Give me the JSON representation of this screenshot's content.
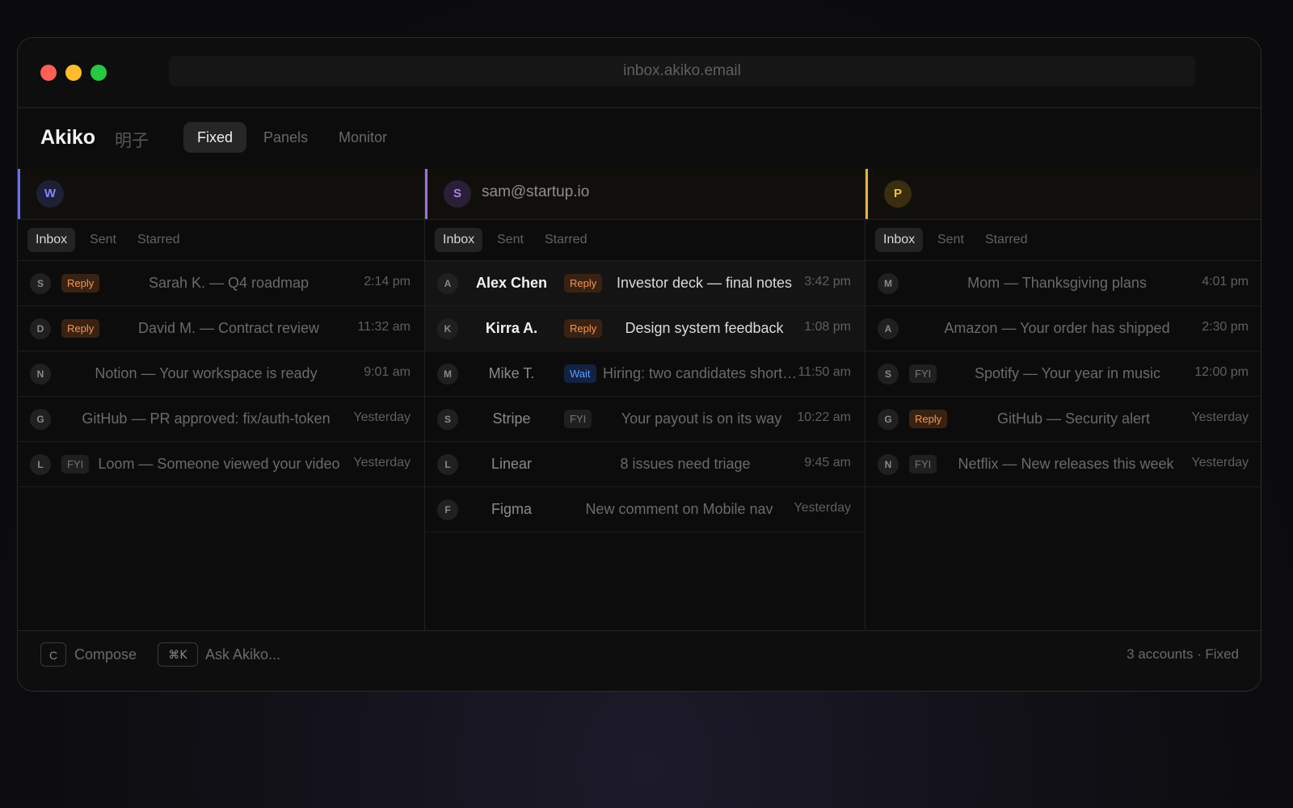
{
  "browser": {
    "url": "inbox.akiko.email"
  },
  "app": {
    "name": "Akiko",
    "name_jp": "明子"
  },
  "modes": [
    {
      "label": "Fixed",
      "active": true
    },
    {
      "label": "Panels",
      "active": false
    },
    {
      "label": "Monitor",
      "active": false
    }
  ],
  "columns": [
    {
      "initial": "W",
      "email": "",
      "accent": "#6b6ff0",
      "tabs": [
        "Inbox",
        "Sent",
        "Starred"
      ],
      "rows": [
        {
          "initial": "S",
          "badge": "Reply",
          "subject": "Sarah K. — Q4 roadmap",
          "time": "2:14 pm"
        },
        {
          "initial": "D",
          "badge": "Reply",
          "subject": "David M. — Contract review",
          "time": "11:32 am"
        },
        {
          "initial": "N",
          "badge": "",
          "subject": "Notion — Your workspace is ready",
          "time": "9:01 am"
        },
        {
          "initial": "G",
          "badge": "",
          "subject": "GitHub — PR approved: fix/auth-token",
          "time": "Yesterday"
        },
        {
          "initial": "L",
          "badge": "FYI",
          "subject": "Loom — Someone viewed your video",
          "time": "Yesterday"
        }
      ]
    },
    {
      "initial": "S",
      "email": "sam@startup.io",
      "accent": "#a070e0",
      "tabs": [
        "Inbox",
        "Sent",
        "Starred"
      ],
      "rows": [
        {
          "initial": "A",
          "sender": "Alex Chen",
          "badge": "Reply",
          "subject": "Investor deck — final notes",
          "time": "3:42 pm"
        },
        {
          "initial": "K",
          "sender": "Kirra A.",
          "badge": "Reply",
          "subject": "Design system feedback",
          "time": "1:08 pm"
        },
        {
          "initial": "M",
          "sender": "Mike T.",
          "badge": "Wait",
          "subject": "Hiring: two candidates shortlisted",
          "time": "11:50 am"
        },
        {
          "initial": "S",
          "sender": "Stripe",
          "badge": "FYI",
          "subject": "Your payout is on its way",
          "time": "10:22 am"
        },
        {
          "initial": "L",
          "sender": "Linear",
          "badge": "",
          "subject": "8 issues need triage",
          "time": "9:45 am"
        },
        {
          "initial": "F",
          "sender": "Figma",
          "badge": "",
          "subject": "New comment on Mobile nav",
          "time": "Yesterday"
        }
      ]
    },
    {
      "initial": "P",
      "email": "",
      "accent": "#e6b43a",
      "tabs": [
        "Inbox",
        "Sent",
        "Starred"
      ],
      "rows": [
        {
          "initial": "M",
          "badge": "",
          "subject": "Mom — Thanksgiving plans",
          "time": "4:01 pm"
        },
        {
          "initial": "A",
          "badge": "",
          "subject": "Amazon — Your order has shipped",
          "time": "2:30 pm"
        },
        {
          "initial": "S",
          "badge": "FYI",
          "subject": "Spotify — Your year in music",
          "time": "12:00 pm"
        },
        {
          "initial": "G",
          "badge": "Reply",
          "subject": "GitHub — Security alert",
          "time": "Yesterday"
        },
        {
          "initial": "N",
          "badge": "FYI",
          "subject": "Netflix — New releases this week",
          "time": "Yesterday"
        }
      ]
    }
  ],
  "footer": {
    "compose_key": "C",
    "compose_label": "Compose",
    "ask_key": "⌘K",
    "ask_label": "Ask Akiko...",
    "status": "3 accounts · Fixed"
  }
}
